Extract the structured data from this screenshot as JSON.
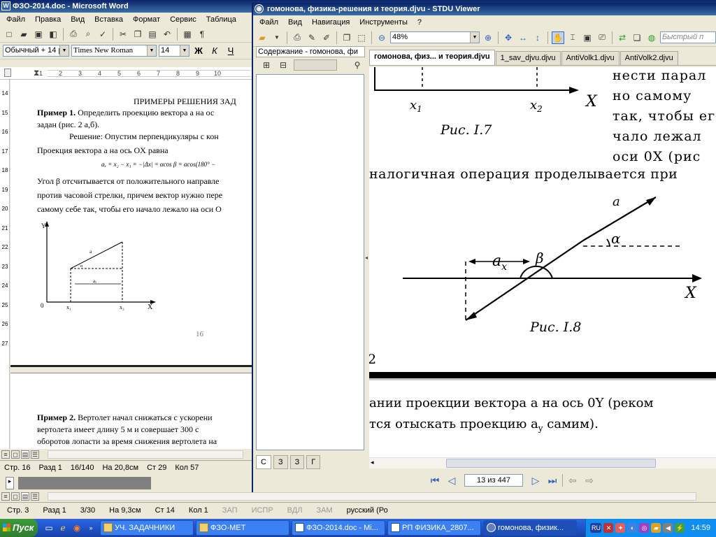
{
  "word": {
    "title": "ФЗО-2014.doc - Microsoft Word",
    "menu": [
      "Файл",
      "Правка",
      "Вид",
      "Вставка",
      "Формат",
      "Сервис",
      "Таблица"
    ],
    "style_value": "Обычный + 14 р",
    "font_value": "Times New Roman",
    "size_value": "14",
    "format_buttons": [
      "Ж",
      "К",
      "Ч"
    ],
    "ruler_marks": [
      "1",
      "2",
      "3",
      "4",
      "5",
      "6",
      "7",
      "8",
      "9",
      "10"
    ],
    "vruler_marks": [
      "14",
      "15",
      "16",
      "17",
      "18",
      "19",
      "20",
      "21",
      "22",
      "23",
      "24",
      "25",
      "26",
      "27"
    ],
    "doc": {
      "heading": "ПРИМЕРЫ РЕШЕНИЯ ЗАД",
      "ex1_label": "Пример 1.",
      "ex1_text": " Определить проекцию вектора  a  на ос",
      "ex1_line2": "задан (рис. 2 а,б).",
      "solution": "Решение: Опустим перпендикуляры с кон",
      "projection": "Проекция вектора  a  на ось OX равна",
      "formula": "aₓ = x₂ − x₁ = −|Δx| = αcos β = αcos(180° −",
      "angle_line1": "Угол β отсчитывается от положительного направле",
      "angle_line2": "против часовой стрелки, причем вектор нужно пере",
      "angle_line3": "самому себе так, чтобы его начало лежало на оси О",
      "fig_labels": {
        "y": "Y",
        "x": "X",
        "o": "0",
        "x1": "x₁",
        "x2": "x₂",
        "ax": "aₓ",
        "a": "a",
        "alpha": "α"
      },
      "page_number": "16",
      "ex2_label": "Пример 2.",
      "ex2_line1": " Вертолет начал снижаться с ускорени",
      "ex2_line2": "вертолета  имеет  длину  5  м  и  совершает  300  с",
      "ex2_line3": "оборотов лопасти за время снижения вертолета на"
    },
    "status": [
      "Стр. 16",
      "Разд 1",
      "16/140",
      "На 20,8см",
      "Ст 29",
      "Кол 57"
    ],
    "status2": [
      "Стр. 3",
      "Разд 1",
      "3/30",
      "На 9,3см",
      "Ст 14",
      "Кол 1"
    ],
    "status2_modes": [
      "ЗАП",
      "ИСПР",
      "ВДЛ",
      "ЗАМ"
    ],
    "status2_lang": "русский (Ро"
  },
  "stdu": {
    "title": "гомонова, физика-решения и теория.djvu - STDU Viewer",
    "menu": [
      "Файл",
      "Вид",
      "Навигация",
      "Инструменты",
      "?"
    ],
    "zoom": "48%",
    "search_placeholder": "Быстрый п",
    "panel_tab": "Содержание - гомонова, фи",
    "panel_bottom_tabs": [
      "С",
      "З",
      "З",
      "Г"
    ],
    "tabs": [
      "гомонова, физ... и теория.djvu",
      "1_sav_djvu.djvu",
      "AntiVolk1.djvu",
      "AntiVolk2.djvu"
    ],
    "page": {
      "fig7_x1": "x",
      "fig7_x1_sub": "1",
      "fig7_x2": "x",
      "fig7_x2_sub": "2",
      "fig7_X": "X",
      "fig7_caption": "Рис. I.7",
      "right_lines": [
        "нести парал",
        "но самому",
        "так, чтобы ег",
        "чало лежал",
        "оси 0X (рис"
      ],
      "analog_line": "налогичная операция проделывается при",
      "fig8_a": "a",
      "fig8_alpha": "α",
      "fig8_ax": "a",
      "fig8_ax_sub": "x",
      "fig8_beta": "β",
      "fig8_X": "X",
      "fig8_caption": "Рис. I.8",
      "page_num": "2",
      "bottom_line1": "ании проекции вектора  a  на ось 0Y (реком",
      "bottom_line2": "тся отыскать проекцию  a",
      "bottom_line2_sub": "y",
      "bottom_line2_end": " самим)."
    },
    "page_indicator": "13 из 447"
  },
  "taskbar": {
    "start": "Пуск",
    "tasks": [
      "УЧ. ЗАДАЧНИКИ",
      "ФЗО-МЕТ",
      "ФЗО-2014.doc - Mi...",
      "РП ФИЗИКА_2807...",
      "гомонова, физик..."
    ],
    "lang": "RU",
    "clock": "14:59"
  }
}
